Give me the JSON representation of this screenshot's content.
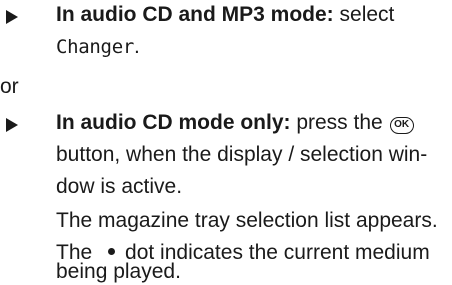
{
  "step1": {
    "bold": "In audio CD and MP3 mode:",
    "text": " select",
    "mono": "Changer",
    "end": "."
  },
  "or": "or",
  "step2": {
    "bold": "In audio CD mode only:",
    "text_before_icon": " press the ",
    "icon_label": "OK",
    "line2": "button, when the display / selection win-",
    "line3": "dow is active."
  },
  "result": {
    "line1": "The magazine tray selection list appears.",
    "line2_before": "The ",
    "line2_after": "dot indicates the current medium",
    "line3": "being played."
  },
  "icons": {
    "bullet": "step-arrow-icon",
    "ok": "ok-button-icon",
    "dot": "current-medium-dot-icon"
  }
}
